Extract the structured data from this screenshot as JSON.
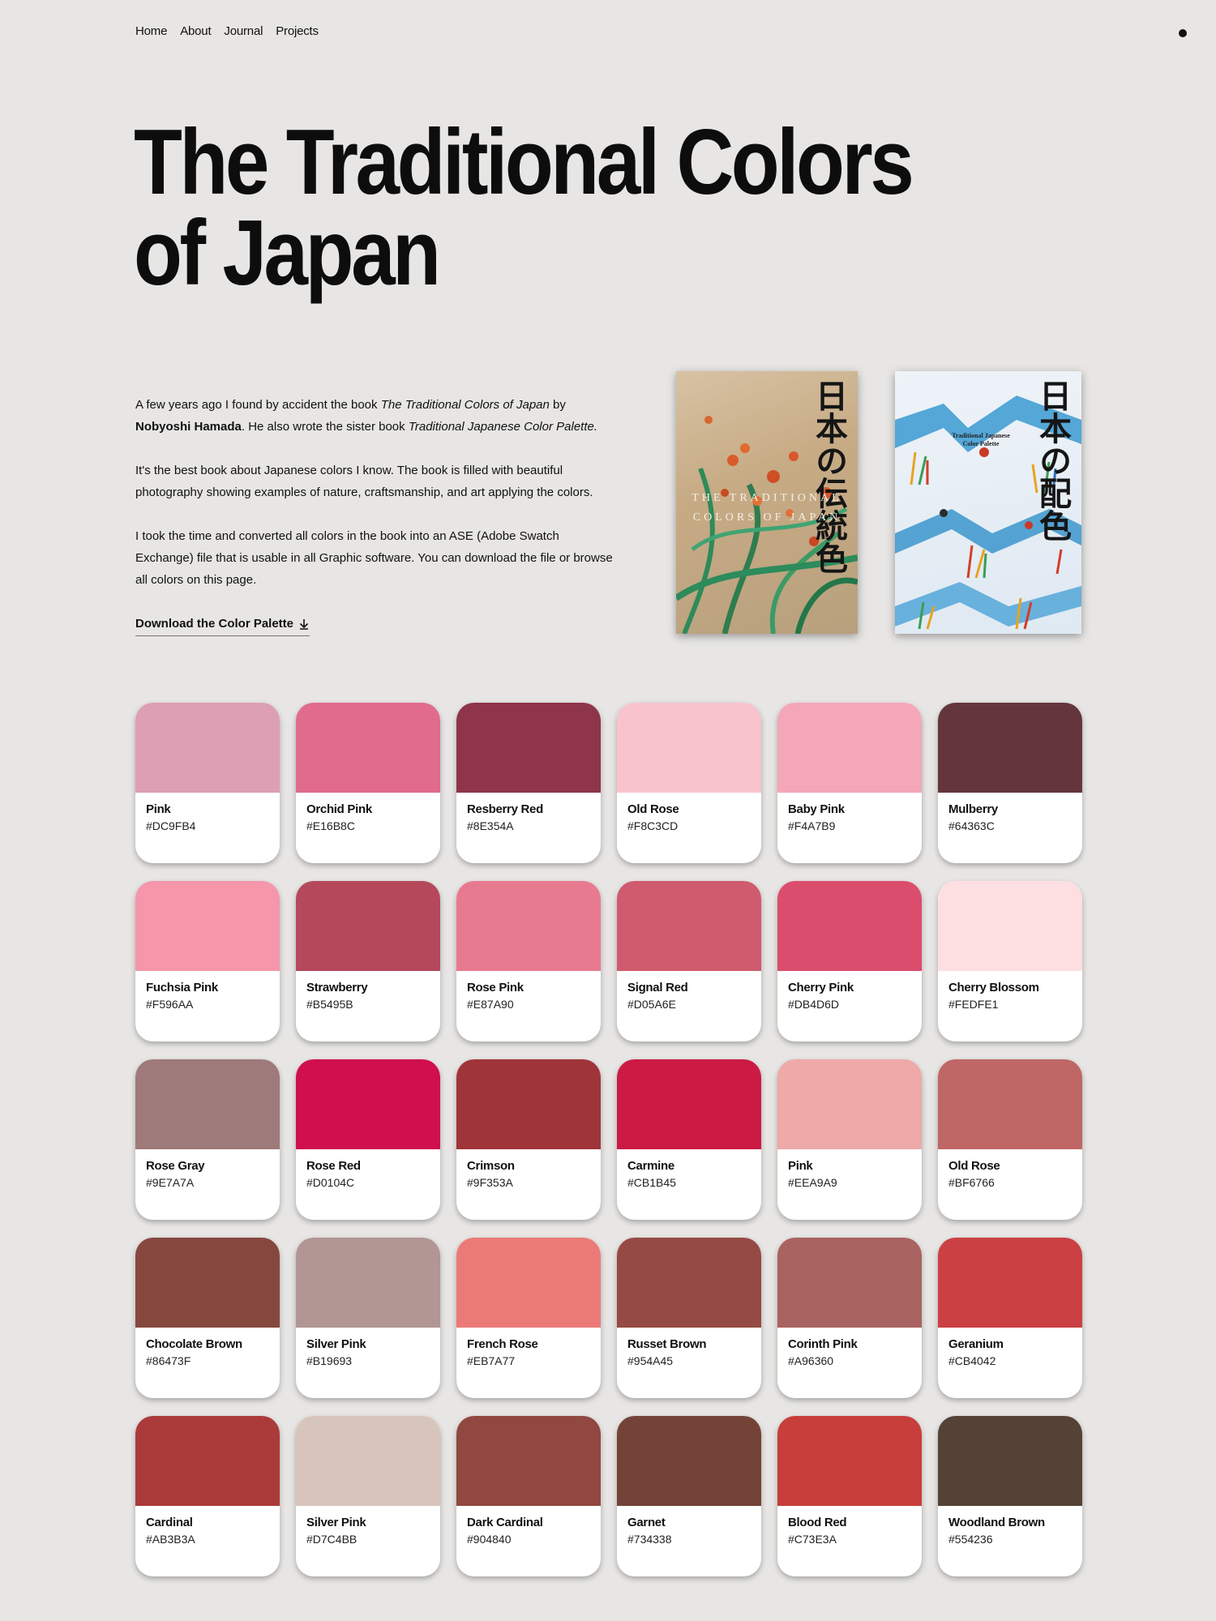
{
  "nav": {
    "items": [
      "Home",
      "About",
      "Journal",
      "Projects"
    ]
  },
  "title": "The Traditional Colors of Japan",
  "intro": {
    "p1_a": "A few years ago I found by accident the book ",
    "p1_b": "The Traditional Colors of Japan",
    "p1_c": " by ",
    "p1_d": "Nobyoshi Hamada",
    "p1_e": ". He also wrote the sister book ",
    "p1_f": "Traditional Japanese Color Palette.",
    "p2": "It's the best book about Japanese colors I know. The book is filled with beautiful photography showing examples of nature, craftsmanship, and art applying the colors.",
    "p3": "I took the time and converted all colors in the book into an ASE (Adobe Swatch Exchange) file that is usable in all Graphic software. You can download the file or browse all colors on this page.",
    "download_label": "Download the Color Palette"
  },
  "books": {
    "book1": {
      "title": "日本の伝統色",
      "subtitle_1": "THE TRADITIONAL",
      "subtitle_2": "COLORS OF JAPAN"
    },
    "book2": {
      "title": "日本の配色",
      "subtitle": "Traditional Japanese Color Palette"
    }
  },
  "colors": [
    {
      "name": "Pink",
      "hex": "#DC9FB4"
    },
    {
      "name": "Orchid Pink",
      "hex": "#E16B8C"
    },
    {
      "name": "Resberry Red",
      "hex": "#8E354A"
    },
    {
      "name": "Old Rose",
      "hex": "#F8C3CD"
    },
    {
      "name": "Baby Pink",
      "hex": "#F4A7B9"
    },
    {
      "name": "Mulberry",
      "hex": "#64363C"
    },
    {
      "name": "Fuchsia Pink",
      "hex": "#F596AA"
    },
    {
      "name": "Strawberry",
      "hex": "#B5495B"
    },
    {
      "name": "Rose Pink",
      "hex": "#E87A90"
    },
    {
      "name": "Signal Red",
      "hex": "#D05A6E"
    },
    {
      "name": "Cherry Pink",
      "hex": "#DB4D6D"
    },
    {
      "name": "Cherry Blossom",
      "hex": "#FEDFE1"
    },
    {
      "name": "Rose Gray",
      "hex": "#9E7A7A"
    },
    {
      "name": "Rose Red",
      "hex": "#D0104C"
    },
    {
      "name": "Crimson",
      "hex": "#9F353A"
    },
    {
      "name": "Carmine",
      "hex": "#CB1B45"
    },
    {
      "name": "Pink",
      "hex": "#EEA9A9"
    },
    {
      "name": "Old Rose",
      "hex": "#BF6766"
    },
    {
      "name": "Chocolate Brown",
      "hex": "#86473F"
    },
    {
      "name": "Silver Pink",
      "hex": "#B19693"
    },
    {
      "name": "French Rose",
      "hex": "#EB7A77"
    },
    {
      "name": "Russet Brown",
      "hex": "#954A45"
    },
    {
      "name": "Corinth Pink",
      "hex": "#A96360"
    },
    {
      "name": "Geranium",
      "hex": "#CB4042"
    },
    {
      "name": "Cardinal",
      "hex": "#AB3B3A"
    },
    {
      "name": "Silver Pink",
      "hex": "#D7C4BB"
    },
    {
      "name": "Dark Cardinal",
      "hex": "#904840"
    },
    {
      "name": "Garnet",
      "hex": "#734338"
    },
    {
      "name": "Blood Red",
      "hex": "#C73E3A"
    },
    {
      "name": "Woodland Brown",
      "hex": "#554236"
    }
  ]
}
